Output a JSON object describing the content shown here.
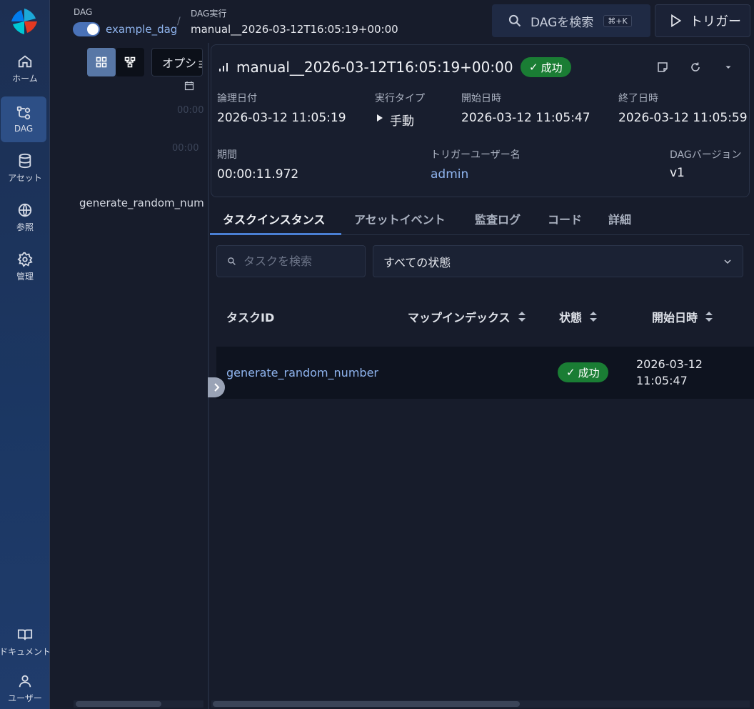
{
  "nav": {
    "items": [
      {
        "label": "ホーム",
        "icon": "home-icon"
      },
      {
        "label": "DAG",
        "icon": "dag-icon"
      },
      {
        "label": "アセット",
        "icon": "database-icon"
      },
      {
        "label": "参照",
        "icon": "globe-icon"
      },
      {
        "label": "管理",
        "icon": "gear-icon"
      }
    ],
    "bottom": [
      {
        "label": "ドキュメント",
        "icon": "book-icon"
      },
      {
        "label": "ユーザー",
        "icon": "user-icon"
      }
    ]
  },
  "header": {
    "dag_label": "DAG",
    "dag_name": "example_dag",
    "run_label": "DAG実行",
    "run_id": "manual__2026-03-12T16:05:19+00:00",
    "search_label": "DAGを検索",
    "search_shortcut": "⌘+K",
    "trigger_label": "トリガー"
  },
  "left_panel": {
    "options_label": "オプション",
    "time_1": "00:00",
    "time_2": "00:00",
    "task_name": "generate_random_number"
  },
  "run_card": {
    "title": "manual__2026-03-12T16:05:19+00:00",
    "status": "成功",
    "logical_date_label": "論理日付",
    "logical_date": "2026-03-12 11:05:19",
    "run_type_label": "実行タイプ",
    "run_type": "手動",
    "start_label": "開始日時",
    "start": "2026-03-12 11:05:47",
    "end_label": "終了日時",
    "end": "2026-03-12 11:05:59",
    "duration_label": "期間",
    "duration": "00:00:11.972",
    "trigger_user_label": "トリガーユーザー名",
    "trigger_user": "admin",
    "dag_version_label": "DAGバージョン",
    "dag_version": "v1"
  },
  "tabs": [
    {
      "label": "タスクインスタンス"
    },
    {
      "label": "アセットイベント"
    },
    {
      "label": "監査ログ"
    },
    {
      "label": "コード"
    },
    {
      "label": "詳細"
    }
  ],
  "filters": {
    "search_placeholder": "タスクを検索",
    "state_value": "すべての状態"
  },
  "table": {
    "headers": [
      "タスクID",
      "マップインデックス",
      "状態",
      "開始日時"
    ],
    "rows": [
      {
        "task_id": "generate_random_number",
        "state": "成功",
        "start_date": "2026-03-12",
        "start_time": "11:05:47"
      }
    ]
  },
  "colors": {
    "success": "#1a7d34",
    "accent": "#4a7fd4",
    "link": "#8fb4ee"
  }
}
